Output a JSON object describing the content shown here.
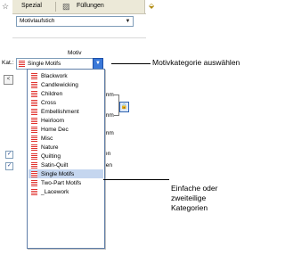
{
  "toolbar": {
    "star_icon": "star-icon",
    "spezial_label": "Spezial",
    "fill_icon": "fill-icon",
    "fuellungen_label": "Füllungen",
    "tab_icon": "bucket-icon"
  },
  "stitch_type": {
    "value": "Motivlaufstich"
  },
  "motiv": {
    "heading": "Motiv",
    "kat_label": "Kat.:",
    "selected": "Single Motifs"
  },
  "field_labels": {
    "mm_1": "mm",
    "mm_2": "mm",
    "mm_3": "mm",
    "text_en": "en",
    "text_ten": "ten"
  },
  "categories": [
    "Blackwork",
    "Candlewicking",
    "Children",
    "Cross",
    "Embellishment",
    "Heirloom",
    "Home Dec",
    "Misc",
    "Nature",
    "Quilting",
    "Satin-Quilt",
    "Single Motifs",
    "Two-Part Motifs",
    "_Lacework"
  ],
  "callouts": {
    "top": "Motivkategorie auswählen",
    "bottom": "Einfache oder zweiteilige Kategorien"
  },
  "colors": {
    "dropdown_accent": "#3a78d8",
    "selection": "#c5d6ef",
    "motif_swatch": "#e0322e"
  }
}
